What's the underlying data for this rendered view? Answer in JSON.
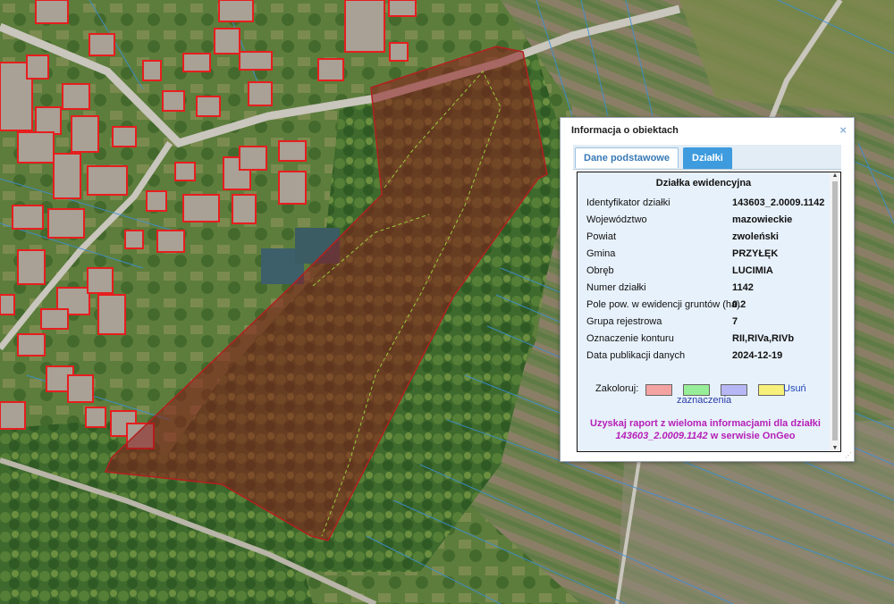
{
  "dialog": {
    "title": "Informacja o obiektach",
    "close_symbol": "×",
    "tabs": [
      {
        "label": "Dane podstawowe",
        "active": true
      },
      {
        "label": "Działki",
        "active": false
      }
    ],
    "section_title": "Działka ewidencyjna",
    "fields": [
      {
        "label": "Identyfikator działki",
        "value": "143603_2.0009.1142"
      },
      {
        "label": "Województwo",
        "value": "mazowieckie"
      },
      {
        "label": "Powiat",
        "value": "zwoleński"
      },
      {
        "label": "Gmina",
        "value": "PRZYŁĘK"
      },
      {
        "label": "Obręb",
        "value": "LUCIMIA"
      },
      {
        "label": "Numer działki",
        "value": "1142"
      },
      {
        "label": "Pole pow. w ewidencji gruntów (ha)",
        "value": "0.2"
      },
      {
        "label": "Grupa rejestrowa",
        "value": "7"
      },
      {
        "label": "Oznaczenie konturu",
        "value": "RII,RIVa,RIVb"
      },
      {
        "label": "Data publikacji danych",
        "value": "2024-12-19"
      }
    ],
    "colorize": {
      "label": "Zakoloruj:",
      "swatches": [
        "#f4a3a3",
        "#98ee98",
        "#b7b7f5",
        "#f7f07a"
      ],
      "remove_label": "Usuń",
      "sublabel": "zaznaczenia"
    },
    "report": {
      "line1": "Uzyskaj raport z wieloma informacjami dla działki",
      "parcel_id": "143603_2.0009.1142",
      "line2_suffix": " w serwisie OnGeo"
    },
    "scroll_up_symbol": "▲",
    "scroll_down_symbol": "▼",
    "resize_symbol": "⋰"
  },
  "colors": {
    "parcel_fill": "#8b1a1a",
    "building_outline": "#e61e1e",
    "parcel_lines": "#3b8fd6",
    "tab_blue": "#3d9bde",
    "link_purple": "#b620b6"
  }
}
